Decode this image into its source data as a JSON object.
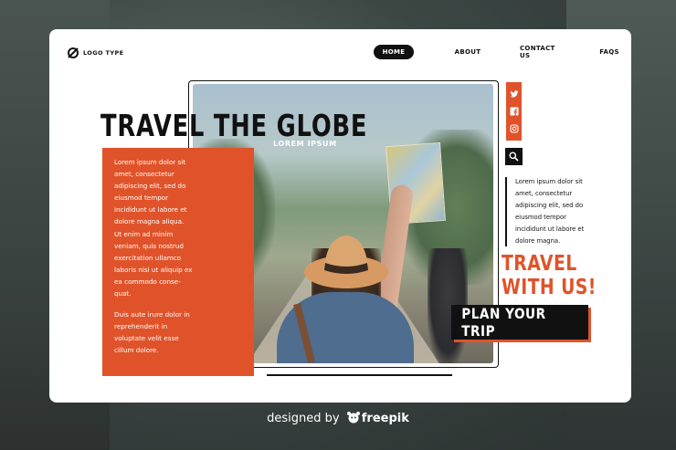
{
  "brand": {
    "logo_text": "LOGO TYPE"
  },
  "nav": {
    "home": "HOME",
    "about": "ABOUT",
    "contact": "CONTACT US",
    "faqs": "FAQS"
  },
  "hero": {
    "title": "TRAVEL THE GLOBE",
    "subtitle": "LOREM IPSUM",
    "carousel": {
      "count": 3,
      "active": 1
    }
  },
  "left_panel": {
    "paragraph1": "Lorem ipsum dolor sit amet, consectetur adipiscing elit, sed do eiusmod tempor incididunt ut labore et dolore magna aliqua. Ut enim ad minim veniam, quis nostrud exercitation ullamco laboris nisi ut aliquip ex ea commodo conse- quat.",
    "paragraph2": "Duis aute irure dolor in reprehenderit in voluptate velit esse cillum dolore."
  },
  "right_panel": {
    "text": "Lorem ipsum dolor sit amet, consectetur adipiscing elit, sed do eiusmod tempor incididunt ut labore et dolore magna.",
    "headline_line1": "TRAVEL",
    "headline_line2": "WITH US!",
    "cta": "PLAN YOUR TRIP"
  },
  "social": [
    "twitter-icon",
    "facebook-icon",
    "instagram-icon"
  ],
  "footer": {
    "designed_by": "designed by",
    "brand": "freepik"
  },
  "colors": {
    "accent": "#e0532a",
    "dark": "#111111",
    "white": "#ffffff"
  }
}
